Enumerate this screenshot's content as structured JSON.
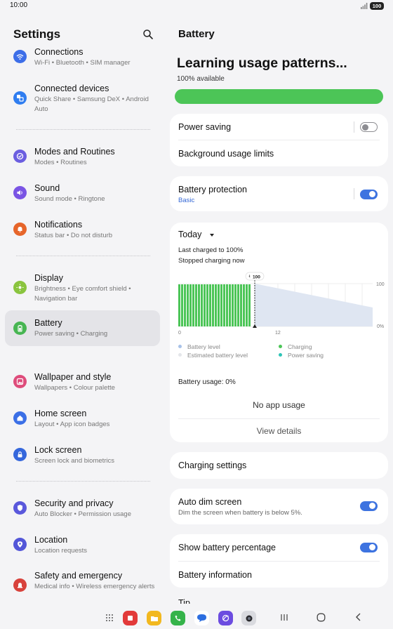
{
  "status_bar": {
    "time": "10:00",
    "battery_level": "100"
  },
  "settings_panel": {
    "title": "Settings",
    "items": [
      {
        "label": "Connections",
        "sub": "Wi-Fi • Bluetooth • SIM manager",
        "icon": "wifi-icon",
        "color": "#3d6ee8"
      },
      {
        "label": "Connected devices",
        "sub": "Quick Share • Samsung DeX • Android Auto",
        "icon": "connected-devices-icon",
        "color": "#2f7df0"
      },
      {
        "label": "Modes and Routines",
        "sub": "Modes • Routines",
        "icon": "modes-icon",
        "color": "#6b5ee0"
      },
      {
        "label": "Sound",
        "sub": "Sound mode • Ringtone",
        "icon": "sound-icon",
        "color": "#7a54e4"
      },
      {
        "label": "Notifications",
        "sub": "Status bar • Do not disturb",
        "icon": "notifications-icon",
        "color": "#e6652a"
      },
      {
        "label": "Display",
        "sub": "Brightness • Eye comfort shield • Navigation bar",
        "icon": "display-icon",
        "color": "#8ac43e"
      },
      {
        "label": "Battery",
        "sub": "Power saving • Charging",
        "icon": "battery-icon",
        "color": "#47b552"
      },
      {
        "label": "Wallpaper and style",
        "sub": "Wallpapers • Colour palette",
        "icon": "wallpaper-icon",
        "color": "#de4c7b"
      },
      {
        "label": "Home screen",
        "sub": "Layout • App icon badges",
        "icon": "home-icon",
        "color": "#3b6fe6"
      },
      {
        "label": "Lock screen",
        "sub": "Screen lock and biometrics",
        "icon": "lock-icon",
        "color": "#3567dc"
      },
      {
        "label": "Security and privacy",
        "sub": "Auto Blocker • Permission usage",
        "icon": "shield-icon",
        "color": "#5a58dc"
      },
      {
        "label": "Location",
        "sub": "Location requests",
        "icon": "location-icon",
        "color": "#5356d8"
      },
      {
        "label": "Safety and emergency",
        "sub": "Medical info • Wireless emergency alerts",
        "icon": "emergency-icon",
        "color": "#d8423c"
      }
    ]
  },
  "battery_panel": {
    "title": "Battery",
    "headline": "Learning usage patterns...",
    "available": "100% available",
    "level_fraction": 1.0,
    "power_saving": {
      "label": "Power saving",
      "on": false
    },
    "background_limits": {
      "label": "Background usage limits"
    },
    "protection": {
      "label": "Battery protection",
      "value": "Basic",
      "on": true
    },
    "usage_card": {
      "period": "Today",
      "last_charged": "Last charged to 100%",
      "stopped": "Stopped charging now",
      "marker_value": "100",
      "y_top": "100",
      "y_bottom": "0%",
      "x_start": "0",
      "x_mid": "12",
      "legend": {
        "battery_level": "Battery level",
        "estimated": "Estimated battery level",
        "charging": "Charging",
        "power_saving": "Power saving"
      },
      "usage_text": "Battery usage: 0%",
      "no_app_usage": "No app usage",
      "view_details": "View details"
    },
    "charging_settings": "Charging settings",
    "auto_dim": {
      "label": "Auto dim screen",
      "sub": "Dim the screen when battery is below 5%.",
      "on": true
    },
    "show_percentage": {
      "label": "Show battery percentage",
      "on": true
    },
    "battery_info": "Battery information",
    "tip": "Tip"
  }
}
